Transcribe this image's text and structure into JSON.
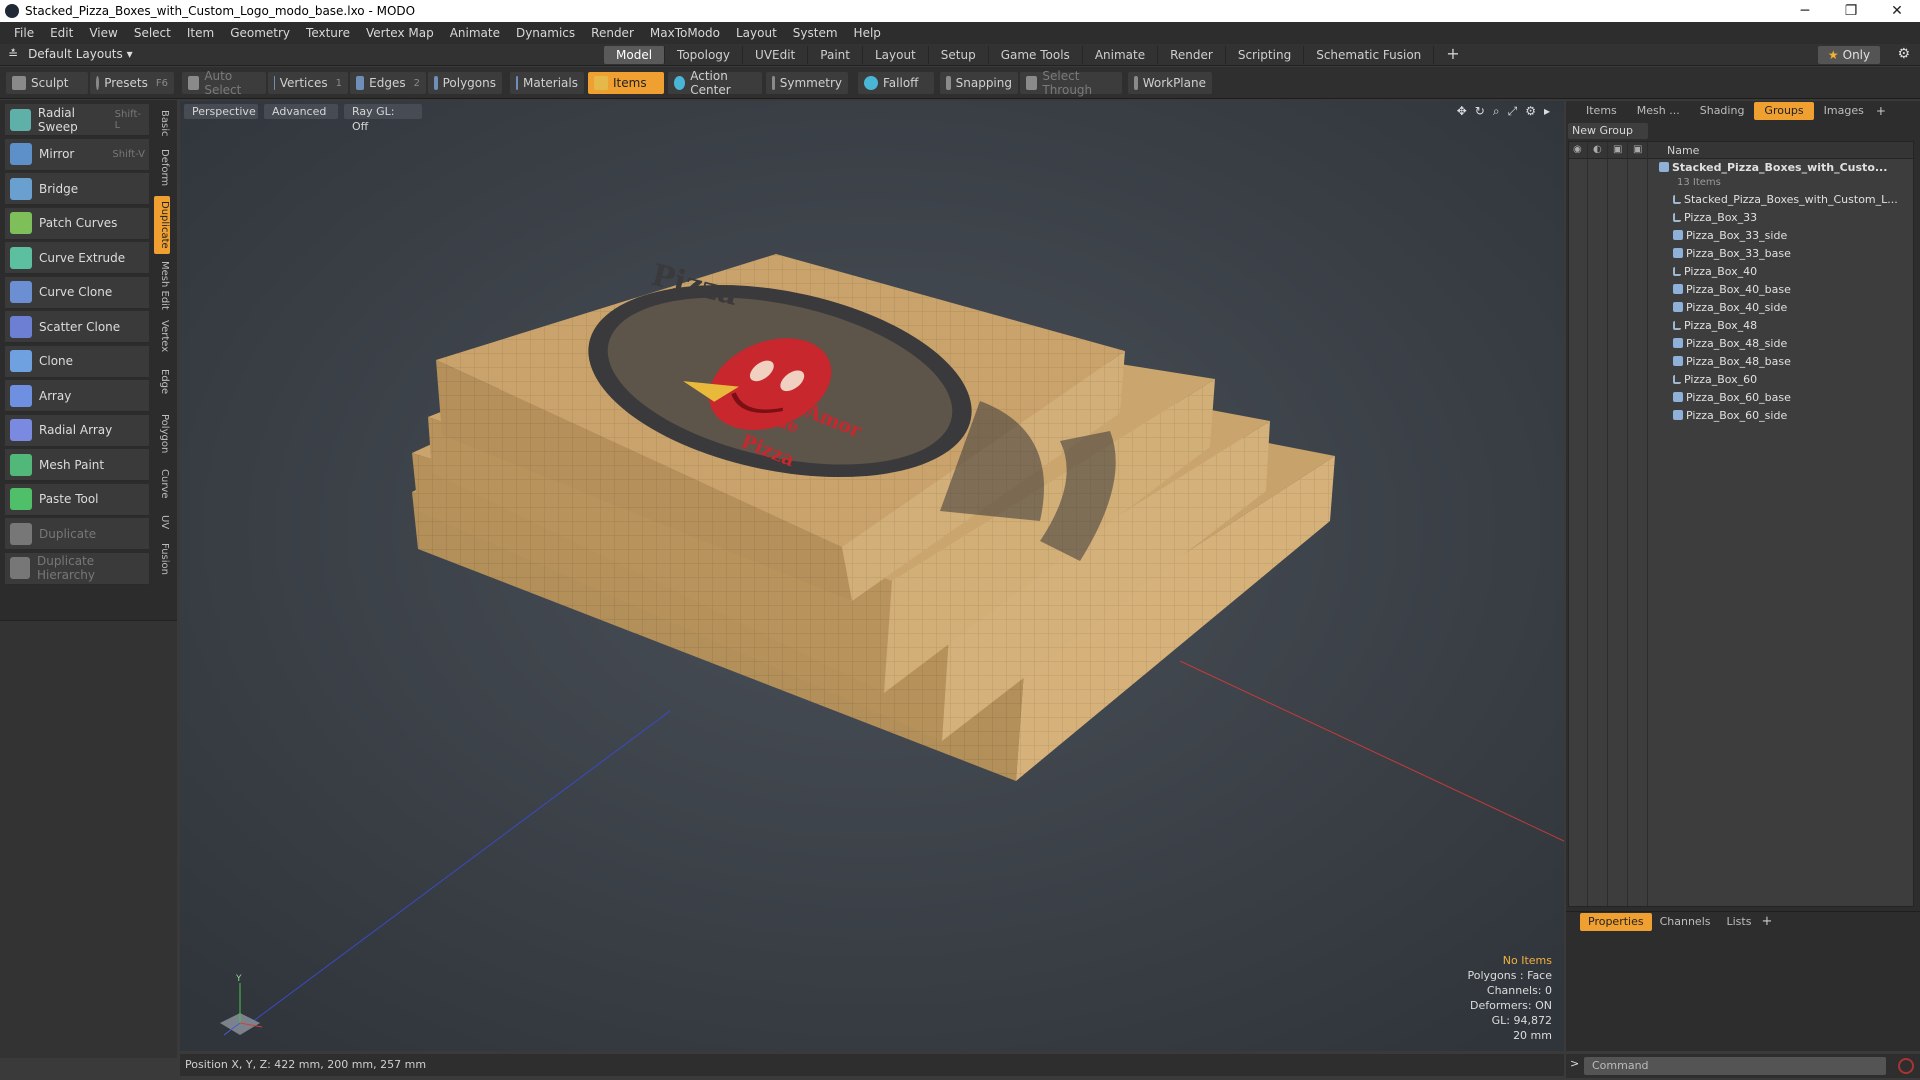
{
  "window": {
    "title": "Stacked_Pizza_Boxes_with_Custom_Logo_modo_base.lxo - MODO",
    "minimize": "─",
    "maximize": "❐",
    "close": "✕"
  },
  "menu": [
    "File",
    "Edit",
    "View",
    "Select",
    "Item",
    "Geometry",
    "Texture",
    "Vertex Map",
    "Animate",
    "Dynamics",
    "Render",
    "MaxToModo",
    "Layout",
    "System",
    "Help"
  ],
  "layout": {
    "selector": "Default Layouts ▾",
    "only": "Only",
    "tabs": [
      "Model",
      "Topology",
      "UVEdit",
      "Paint",
      "Layout",
      "Setup",
      "Game Tools",
      "Animate",
      "Render",
      "Scripting",
      "Schematic Fusion",
      "+"
    ],
    "active_tab": "Model"
  },
  "toolbar": {
    "sculpt": "Sculpt",
    "presets": "Presets",
    "presets_key": "F6",
    "auto_select": "Auto Select",
    "vertices": "Vertices",
    "vertices_count": "1",
    "edges": "Edges",
    "edges_count": "2",
    "polygons": "Polygons",
    "materials": "Materials",
    "items": "Items",
    "action_center": "Action Center",
    "symmetry": "Symmetry",
    "falloff": "Falloff",
    "snapping": "Snapping",
    "select_through": "Select Through",
    "workplane": "WorkPlane"
  },
  "tools": [
    {
      "label": "Radial Sweep",
      "shortcut": "Shift-L",
      "color": "#5fb0a8"
    },
    {
      "label": "Mirror",
      "shortcut": "Shift-V",
      "color": "#5d8fc9"
    },
    {
      "label": "Bridge",
      "shortcut": "",
      "color": "#6aa0d0"
    },
    {
      "label": "Patch Curves",
      "shortcut": "",
      "color": "#7fbf5a"
    },
    {
      "label": "Curve Extrude",
      "shortcut": "",
      "color": "#5cc0a0"
    },
    {
      "label": "Curve Clone",
      "shortcut": "",
      "color": "#6c8ed2"
    },
    {
      "label": "Scatter Clone",
      "shortcut": "",
      "color": "#6c7fd2"
    },
    {
      "label": "Clone",
      "shortcut": "",
      "color": "#6fa0e0"
    },
    {
      "label": "Array",
      "shortcut": "",
      "color": "#6f90e0"
    },
    {
      "label": "Radial Array",
      "shortcut": "",
      "color": "#7a8ae0"
    },
    {
      "label": "Mesh Paint",
      "shortcut": "",
      "color": "#52b87a"
    },
    {
      "label": "Paste Tool",
      "shortcut": "",
      "color": "#4fbf6a"
    },
    {
      "label": "Duplicate",
      "shortcut": "",
      "color": "#777777"
    },
    {
      "label": "Duplicate Hierarchy",
      "shortcut": "",
      "color": "#777777"
    }
  ],
  "vtabs": [
    "Basic",
    "Deform",
    "Duplicate",
    "Mesh Edit",
    "Vertex",
    "Edge",
    "Polygon",
    "Curve",
    "UV",
    "Fusion"
  ],
  "vtab_active": "Duplicate",
  "viewport": {
    "view": "Perspective",
    "mode": "Advanced",
    "raygl": "Ray GL: Off",
    "icons": [
      "move-icon",
      "rotate-icon",
      "zoom-icon",
      "maximize-icon",
      "settings-icon",
      "play-icon"
    ],
    "stats": [
      "No Items",
      "Polygons : Face",
      "Channels: 0",
      "Deformers: ON",
      "GL: 94,872",
      "20 mm"
    ],
    "logo_text": "Pizza",
    "logo_tagline_1": "Con Amor",
    "logo_tagline_2": "de",
    "logo_tagline_3": "Pizza",
    "axis_y": "Y"
  },
  "status": {
    "position": "Position X, Y, Z:  422 mm, 200 mm, 257 mm"
  },
  "right": {
    "tabs": [
      "Items",
      "Mesh ...",
      "Shading",
      "Groups",
      "Images"
    ],
    "active_tab": "Groups",
    "new_group": "New Group",
    "name_col": "Name",
    "group_name": "Stacked_Pizza_Boxes_with_Custo...",
    "group_count": "13 Items",
    "items": [
      {
        "name": "Stacked_Pizza_Boxes_with_Custom_L...",
        "type": "loc"
      },
      {
        "name": "Pizza_Box_33",
        "type": "loc"
      },
      {
        "name": "Pizza_Box_33_side",
        "type": "mesh"
      },
      {
        "name": "Pizza_Box_33_base",
        "type": "mesh"
      },
      {
        "name": "Pizza_Box_40",
        "type": "loc"
      },
      {
        "name": "Pizza_Box_40_base",
        "type": "mesh"
      },
      {
        "name": "Pizza_Box_40_side",
        "type": "mesh"
      },
      {
        "name": "Pizza_Box_48",
        "type": "loc"
      },
      {
        "name": "Pizza_Box_48_side",
        "type": "mesh"
      },
      {
        "name": "Pizza_Box_48_base",
        "type": "mesh"
      },
      {
        "name": "Pizza_Box_60",
        "type": "loc"
      },
      {
        "name": "Pizza_Box_60_base",
        "type": "mesh"
      },
      {
        "name": "Pizza_Box_60_side",
        "type": "mesh"
      }
    ]
  },
  "properties": {
    "tabs": [
      "Properties",
      "Channels",
      "Lists"
    ],
    "active": "Properties",
    "plus": "+"
  },
  "command": {
    "placeholder": "Command"
  },
  "colors": {
    "accent": "#f0a030",
    "cardboard": "#c9a46a",
    "logo_red": "#c8272d",
    "logo_dark": "#3c3b3d"
  }
}
